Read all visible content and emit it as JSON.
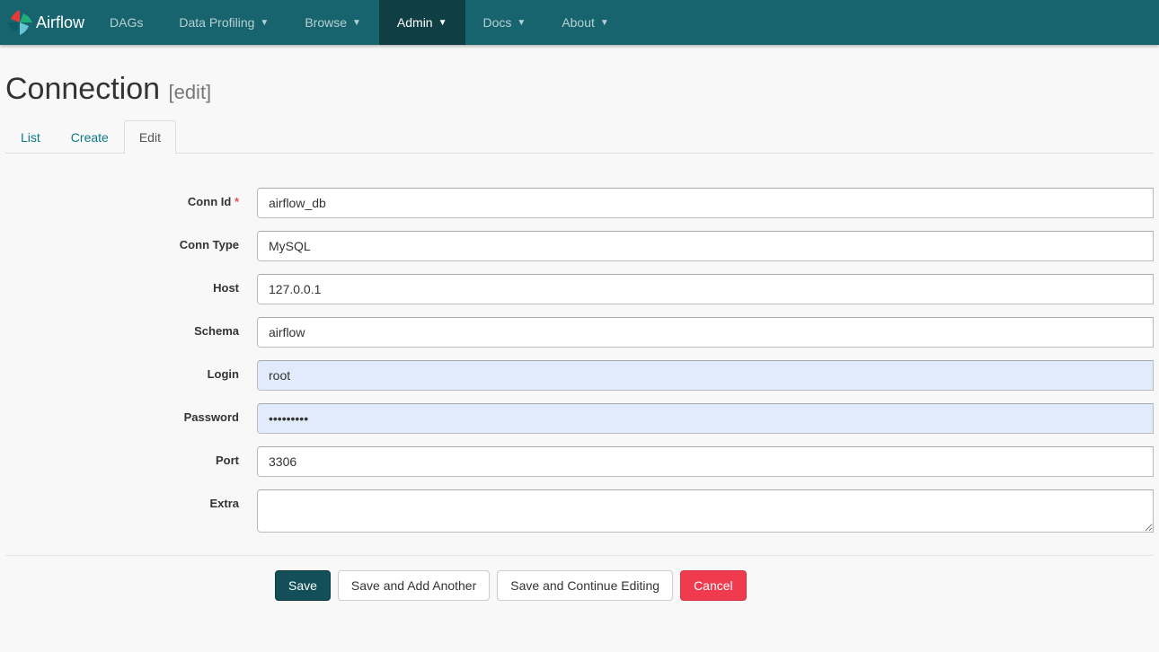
{
  "nav": {
    "brand": "Airflow",
    "items": [
      {
        "label": "DAGs",
        "caret": false,
        "active": false
      },
      {
        "label": "Data Profiling",
        "caret": true,
        "active": false
      },
      {
        "label": "Browse",
        "caret": true,
        "active": false
      },
      {
        "label": "Admin",
        "caret": true,
        "active": true
      },
      {
        "label": "Docs",
        "caret": true,
        "active": false
      },
      {
        "label": "About",
        "caret": true,
        "active": false
      }
    ]
  },
  "page": {
    "title": "Connection",
    "title_suffix": "[edit]"
  },
  "tabs": [
    {
      "label": "List",
      "active": false
    },
    {
      "label": "Create",
      "active": false
    },
    {
      "label": "Edit",
      "active": true
    }
  ],
  "form": {
    "conn_id": {
      "label": "Conn Id",
      "required": true,
      "value": "airflow_db"
    },
    "conn_type": {
      "label": "Conn Type",
      "value": "MySQL"
    },
    "host": {
      "label": "Host",
      "value": "127.0.0.1"
    },
    "schema": {
      "label": "Schema",
      "value": "airflow"
    },
    "login": {
      "label": "Login",
      "value": "root"
    },
    "password": {
      "label": "Password",
      "value": "•••••••••"
    },
    "port": {
      "label": "Port",
      "value": "3306"
    },
    "extra": {
      "label": "Extra",
      "value": ""
    }
  },
  "actions": {
    "save": "Save",
    "save_add": "Save and Add Another",
    "save_cont": "Save and Continue Editing",
    "cancel": "Cancel"
  }
}
